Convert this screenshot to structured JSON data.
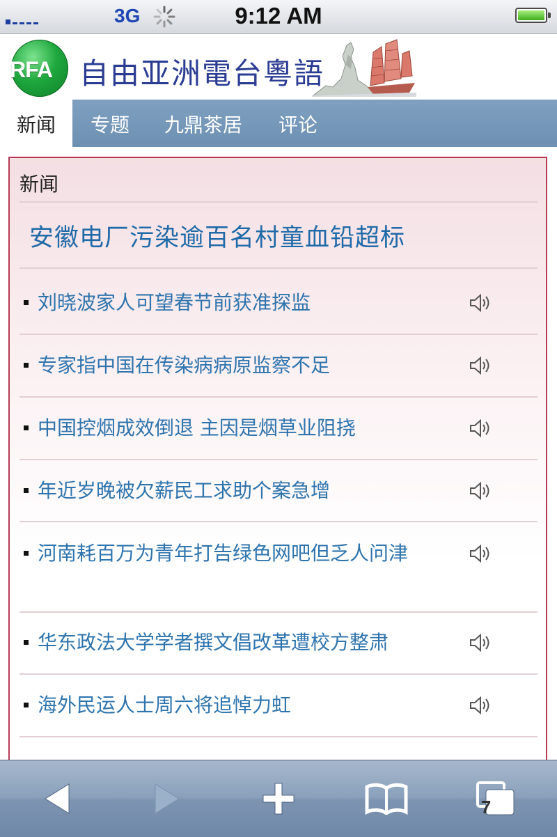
{
  "status_bar": {
    "carrier": "3G",
    "time": "9:12 AM"
  },
  "site": {
    "logo_text": "RFA",
    "title": "自由亚洲電台粵語",
    "brand_color": "#1fa83e",
    "title_color": "#2b3c93"
  },
  "nav": {
    "tabs": [
      {
        "label": "新闻",
        "active": true
      },
      {
        "label": "专题",
        "active": false
      },
      {
        "label": "九鼎茶居",
        "active": false
      },
      {
        "label": "评论",
        "active": false
      }
    ]
  },
  "content": {
    "section_title": "新闻",
    "headline": "安徽电厂污染逾百名村童血铅超标",
    "items": [
      {
        "title": "刘晓波家人可望春节前获准探监",
        "icon": "speaker-icon"
      },
      {
        "title": "专家指中国在传染病病原监察不足",
        "icon": "speaker-icon"
      },
      {
        "title": "中国控烟成效倒退 主因是烟草业阻挠",
        "icon": "speaker-icon"
      },
      {
        "title": "年近岁晚被欠薪民工求助个案急增",
        "icon": "speaker-icon"
      },
      {
        "title": "河南耗百万为青年打告绿色网吧但乏人问津",
        "icon": "speaker-icon"
      },
      {
        "title": "华东政法大学学者撰文倡改革遭校方整肃",
        "icon": "speaker-icon"
      },
      {
        "title": "海外民运人士周六将追悼力虹",
        "icon": "speaker-icon"
      }
    ],
    "link_color": "#2e74ad",
    "border_color": "#b63a55"
  },
  "toolbar": {
    "tabs_count": "7",
    "icons": [
      "back-arrow-icon",
      "forward-arrow-icon",
      "add-icon",
      "bookmarks-icon",
      "pages-icon"
    ]
  }
}
